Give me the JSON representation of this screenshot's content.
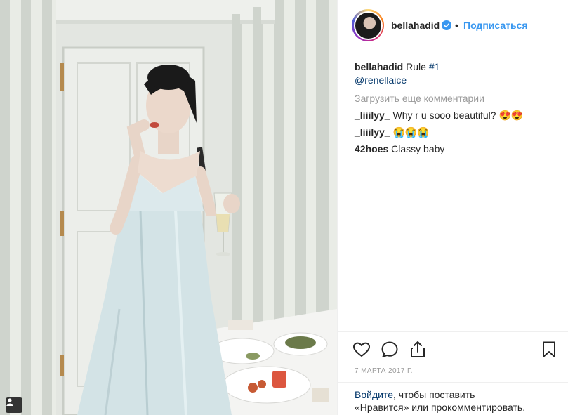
{
  "post": {
    "username": "bellahadid",
    "follow_label": "Подписаться",
    "separator": "•",
    "caption_user": "bellahadid",
    "caption_text": " Rule ",
    "caption_hashtag": "#1",
    "caption_mention": "@renellaice",
    "load_more_label": "Загрузить еще комментарии",
    "comments": [
      {
        "user": "_liiilyy_",
        "text": " Why r u sooo beautiful? 😍😍"
      },
      {
        "user": "_liiilyy_",
        "text": " 😭😭😭"
      },
      {
        "user": "42hoes",
        "text": " Classy baby"
      }
    ],
    "date": "7 МАРТА 2017 Г.",
    "login_link": "Войдите",
    "login_text_1": ", чтобы поставить",
    "login_text_2": "«Нравится» или прокомментировать."
  },
  "icons": {
    "verified": "verified-badge-icon",
    "like": "heart-icon",
    "comment": "comment-icon",
    "share": "share-icon",
    "save": "bookmark-icon",
    "tag": "user-tag-icon"
  },
  "colors": {
    "link": "#3897f0",
    "dark_link": "#003569",
    "muted": "#999999",
    "text": "#262626",
    "border": "#efefef"
  }
}
